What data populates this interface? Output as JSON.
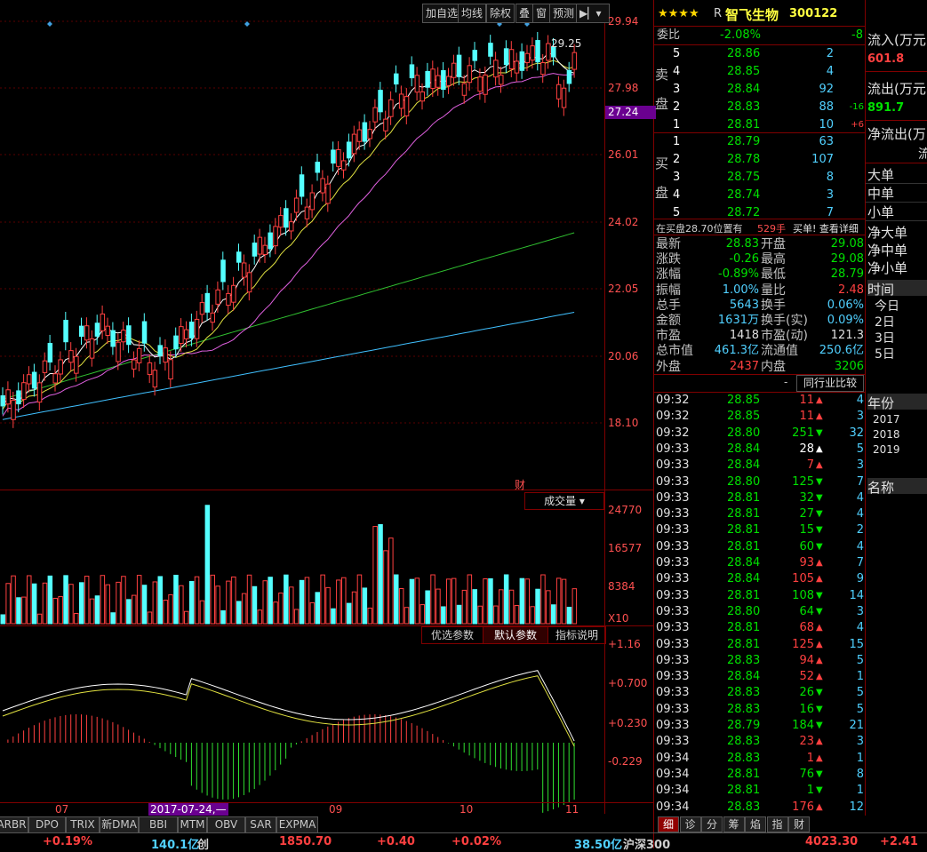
{
  "toolbar": {
    "add_pick": "加自选",
    "ma": "均线",
    "exright": "除权",
    "overlay": "叠",
    "window": "窗",
    "forecast": "预测",
    "last_icon": "forward-icon"
  },
  "stock": {
    "stars": "★★★★",
    "tag": "R",
    "name": "智飞生物",
    "code": "300122"
  },
  "price_axis": [
    "29.94",
    "27.98",
    "26.01",
    "24.02",
    "22.05",
    "20.06",
    "18.10"
  ],
  "current_price": "27.24",
  "high_annot": "29.25",
  "vol_axis": [
    "24770",
    "16577",
    "8384",
    "X10"
  ],
  "macd_axis": [
    "+1.16",
    "+0.700",
    "+0.230",
    "-0.229"
  ],
  "vol_header": {
    "cai": "财",
    "label": "成交量"
  },
  "indicator_buttons": {
    "opt": "优选参数",
    "def": "默认参数",
    "help": "指标说明"
  },
  "x_axis": {
    "m07": "07",
    "date": "2017-07-24,",
    "m09": "09",
    "m10": "10",
    "m11": "11"
  },
  "bottom_tabs": [
    "ARBR",
    "DPO",
    "TRIX",
    "新DMA",
    "BBI",
    "MTM",
    "OBV",
    "SAR",
    "EXPMA"
  ],
  "webi": {
    "label": "委比",
    "value": "-2.08%",
    "diff": "-8"
  },
  "sell_label": [
    "卖",
    "盘"
  ],
  "buy_label": [
    "买",
    "盘"
  ],
  "asks": [
    {
      "lvl": "5",
      "price": "28.86",
      "vol": "2",
      "chg": ""
    },
    {
      "lvl": "4",
      "price": "28.85",
      "vol": "4",
      "chg": ""
    },
    {
      "lvl": "3",
      "price": "28.84",
      "vol": "92",
      "chg": ""
    },
    {
      "lvl": "2",
      "price": "28.83",
      "vol": "88",
      "chg": "-16"
    },
    {
      "lvl": "1",
      "price": "28.81",
      "vol": "10",
      "chg": "+6"
    }
  ],
  "bids": [
    {
      "lvl": "1",
      "price": "28.79",
      "vol": "63"
    },
    {
      "lvl": "2",
      "price": "28.78",
      "vol": "107"
    },
    {
      "lvl": "3",
      "price": "28.75",
      "vol": "8"
    },
    {
      "lvl": "4",
      "price": "28.74",
      "vol": "3"
    },
    {
      "lvl": "5",
      "price": "28.72",
      "vol": "7"
    }
  ],
  "buy_note": {
    "text": "在买盘28.70位置有",
    "vol": "529手",
    "link": "买单! 查看详细"
  },
  "quote": [
    {
      "l": "最新",
      "v": "28.83",
      "vc": "green",
      "l2": "开盘",
      "v2": "29.08",
      "v2c": "green"
    },
    {
      "l": "涨跌",
      "v": "-0.26",
      "vc": "green",
      "l2": "最高",
      "v2": "29.08",
      "v2c": "green"
    },
    {
      "l": "涨幅",
      "v": "-0.89%",
      "vc": "green",
      "l2": "最低",
      "v2": "28.79",
      "v2c": "green"
    },
    {
      "l": "振幅",
      "v": "1.00%",
      "vc": "cyan",
      "l2": "量比",
      "v2": "2.48",
      "v2c": "red"
    },
    {
      "l": "总手",
      "v": "5643",
      "vc": "cyan",
      "l2": "换手",
      "v2": "0.06%",
      "v2c": "cyan"
    },
    {
      "l": "金额",
      "v": "1631万",
      "vc": "cyan",
      "l2": "换手(实)",
      "v2": "0.09%",
      "v2c": "cyan"
    },
    {
      "l": "市盈",
      "v": "1418",
      "vc": "white",
      "l2": "市盈(动)",
      "v2": "121.3",
      "v2c": "white"
    },
    {
      "l": "总市值",
      "v": "461.3亿",
      "vc": "cyan",
      "l2": "流通值",
      "v2": "250.6亿",
      "v2c": "cyan"
    },
    {
      "l": "外盘",
      "v": "2437",
      "vc": "red",
      "l2": "内盘",
      "v2": "3206",
      "v2c": "green"
    }
  ],
  "compare": {
    "dash": "-",
    "label": "同行业比较"
  },
  "ticks": [
    {
      "t": "09:32",
      "p": "28.85",
      "pc": "green",
      "v": "11",
      "vc": "red",
      "d": "up",
      "n": "4"
    },
    {
      "t": "09:32",
      "p": "28.85",
      "pc": "green",
      "v": "11",
      "vc": "red",
      "d": "up",
      "n": "3"
    },
    {
      "t": "09:32",
      "p": "28.80",
      "pc": "green",
      "v": "251",
      "vc": "green",
      "d": "down",
      "n": "32"
    },
    {
      "t": "09:33",
      "p": "28.84",
      "pc": "green",
      "v": "28",
      "vc": "white",
      "d": "upw",
      "n": "5"
    },
    {
      "t": "09:33",
      "p": "28.84",
      "pc": "green",
      "v": "7",
      "vc": "red",
      "d": "up",
      "n": "3"
    },
    {
      "t": "09:33",
      "p": "28.80",
      "pc": "green",
      "v": "125",
      "vc": "green",
      "d": "down",
      "n": "7"
    },
    {
      "t": "09:33",
      "p": "28.81",
      "pc": "green",
      "v": "32",
      "vc": "green",
      "d": "down",
      "n": "4"
    },
    {
      "t": "09:33",
      "p": "28.81",
      "pc": "green",
      "v": "27",
      "vc": "green",
      "d": "down",
      "n": "4"
    },
    {
      "t": "09:33",
      "p": "28.81",
      "pc": "green",
      "v": "15",
      "vc": "green",
      "d": "down",
      "n": "2"
    },
    {
      "t": "09:33",
      "p": "28.81",
      "pc": "green",
      "v": "60",
      "vc": "green",
      "d": "down",
      "n": "4"
    },
    {
      "t": "09:33",
      "p": "28.84",
      "pc": "green",
      "v": "93",
      "vc": "red",
      "d": "up",
      "n": "7"
    },
    {
      "t": "09:33",
      "p": "28.84",
      "pc": "green",
      "v": "105",
      "vc": "red",
      "d": "up",
      "n": "9"
    },
    {
      "t": "09:33",
      "p": "28.81",
      "pc": "green",
      "v": "108",
      "vc": "green",
      "d": "down",
      "n": "14"
    },
    {
      "t": "09:33",
      "p": "28.80",
      "pc": "green",
      "v": "64",
      "vc": "green",
      "d": "down",
      "n": "3"
    },
    {
      "t": "09:33",
      "p": "28.81",
      "pc": "green",
      "v": "68",
      "vc": "red",
      "d": "up",
      "n": "4"
    },
    {
      "t": "09:33",
      "p": "28.81",
      "pc": "green",
      "v": "125",
      "vc": "red",
      "d": "up",
      "n": "15"
    },
    {
      "t": "09:33",
      "p": "28.83",
      "pc": "green",
      "v": "94",
      "vc": "red",
      "d": "up",
      "n": "5"
    },
    {
      "t": "09:33",
      "p": "28.84",
      "pc": "green",
      "v": "52",
      "vc": "red",
      "d": "up",
      "n": "1"
    },
    {
      "t": "09:33",
      "p": "28.83",
      "pc": "green",
      "v": "26",
      "vc": "green",
      "d": "down",
      "n": "5"
    },
    {
      "t": "09:33",
      "p": "28.83",
      "pc": "green",
      "v": "16",
      "vc": "green",
      "d": "down",
      "n": "5"
    },
    {
      "t": "09:33",
      "p": "28.79",
      "pc": "green",
      "v": "184",
      "vc": "green",
      "d": "down",
      "n": "21"
    },
    {
      "t": "09:33",
      "p": "28.83",
      "pc": "green",
      "v": "23",
      "vc": "red",
      "d": "up",
      "n": "3"
    },
    {
      "t": "09:34",
      "p": "28.83",
      "pc": "green",
      "v": "1",
      "vc": "red",
      "d": "up",
      "n": "1"
    },
    {
      "t": "09:34",
      "p": "28.81",
      "pc": "green",
      "v": "76",
      "vc": "green",
      "d": "down",
      "n": "8"
    },
    {
      "t": "09:34",
      "p": "28.81",
      "pc": "green",
      "v": "1",
      "vc": "green",
      "d": "down",
      "n": "1"
    },
    {
      "t": "09:34",
      "p": "28.83",
      "pc": "green",
      "v": "176",
      "vc": "red",
      "d": "up",
      "n": "12"
    }
  ],
  "detail_tabs": [
    "细",
    "诊",
    "分",
    "筹",
    "焰",
    "指",
    "财"
  ],
  "flow": {
    "in_label": "流入(万元",
    "in_value": "601.8",
    "out_label": "流出(万元",
    "out_value": "891.7",
    "net_label": "净流出(万",
    "net_right": "流",
    "rows": [
      "大单",
      "中单",
      "小单"
    ],
    "rows2": [
      "净大单",
      "净中单",
      "净小单"
    ],
    "time": "时间",
    "days": [
      "今日",
      "2日",
      "3日",
      "5日"
    ],
    "year": "年份",
    "years": [
      "2017",
      "2018",
      "2019"
    ],
    "name": "名称"
  },
  "status": {
    "a": "+0.19%",
    "b": "140.1亿",
    "c": "创",
    "d": "1850.70",
    "e": "+0.40",
    "f": "+0.02%",
    "g": "38.50亿",
    "h": "沪深300",
    "i": "4023.30",
    "j": "+2.41"
  }
}
